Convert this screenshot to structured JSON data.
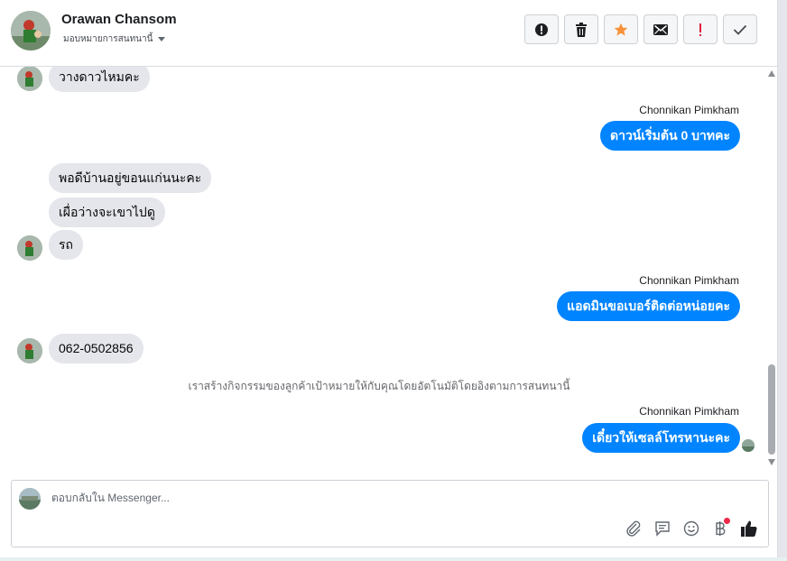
{
  "header": {
    "name": "Orawan Chansom",
    "assign_label": "มอบหมายการสนทนานี้",
    "actions": [
      {
        "icon": "alert-icon"
      },
      {
        "icon": "trash-icon"
      },
      {
        "icon": "star-icon"
      },
      {
        "icon": "envelope-icon"
      },
      {
        "icon": "exclamation-icon"
      },
      {
        "icon": "check-icon"
      }
    ]
  },
  "thread": {
    "m1": "วางดาวไหมคะ",
    "sender1": "Chonnikan Pimkham",
    "m2": "ดาวน์เริ่มต้น 0 บาทคะ",
    "m3": "พอดีบ้านอยู่ขอนแก่นนะคะ",
    "m4": "เผื่อว่างจะเขาไปดู",
    "m5": "รถ",
    "sender2": "Chonnikan Pimkham",
    "m6": "แอดมินขอเบอร์ติดต่อหน่อยคะ",
    "m7": "062-0502856",
    "system_note": "เราสร้างกิจกรรมของลูกค้าเป้าหมายให้กับคุณโดยอัตโนมัติโดยอิงตามการสนทนานี้",
    "sender3": "Chonnikan Pimkham",
    "m8": "เดี๋ยวให้เซลล์โทรหานะคะ"
  },
  "composer": {
    "placeholder": "ตอบกลับใน Messenger...",
    "tools": [
      "paperclip-icon",
      "saved-reply-icon",
      "emoji-icon",
      "baht-icon",
      "like-icon"
    ]
  },
  "colors": {
    "outgoing_bubble": "#0084ff",
    "incoming_bubble": "#e4e6eb",
    "star": "#f7923b",
    "exclamation": "#e41e3f"
  }
}
